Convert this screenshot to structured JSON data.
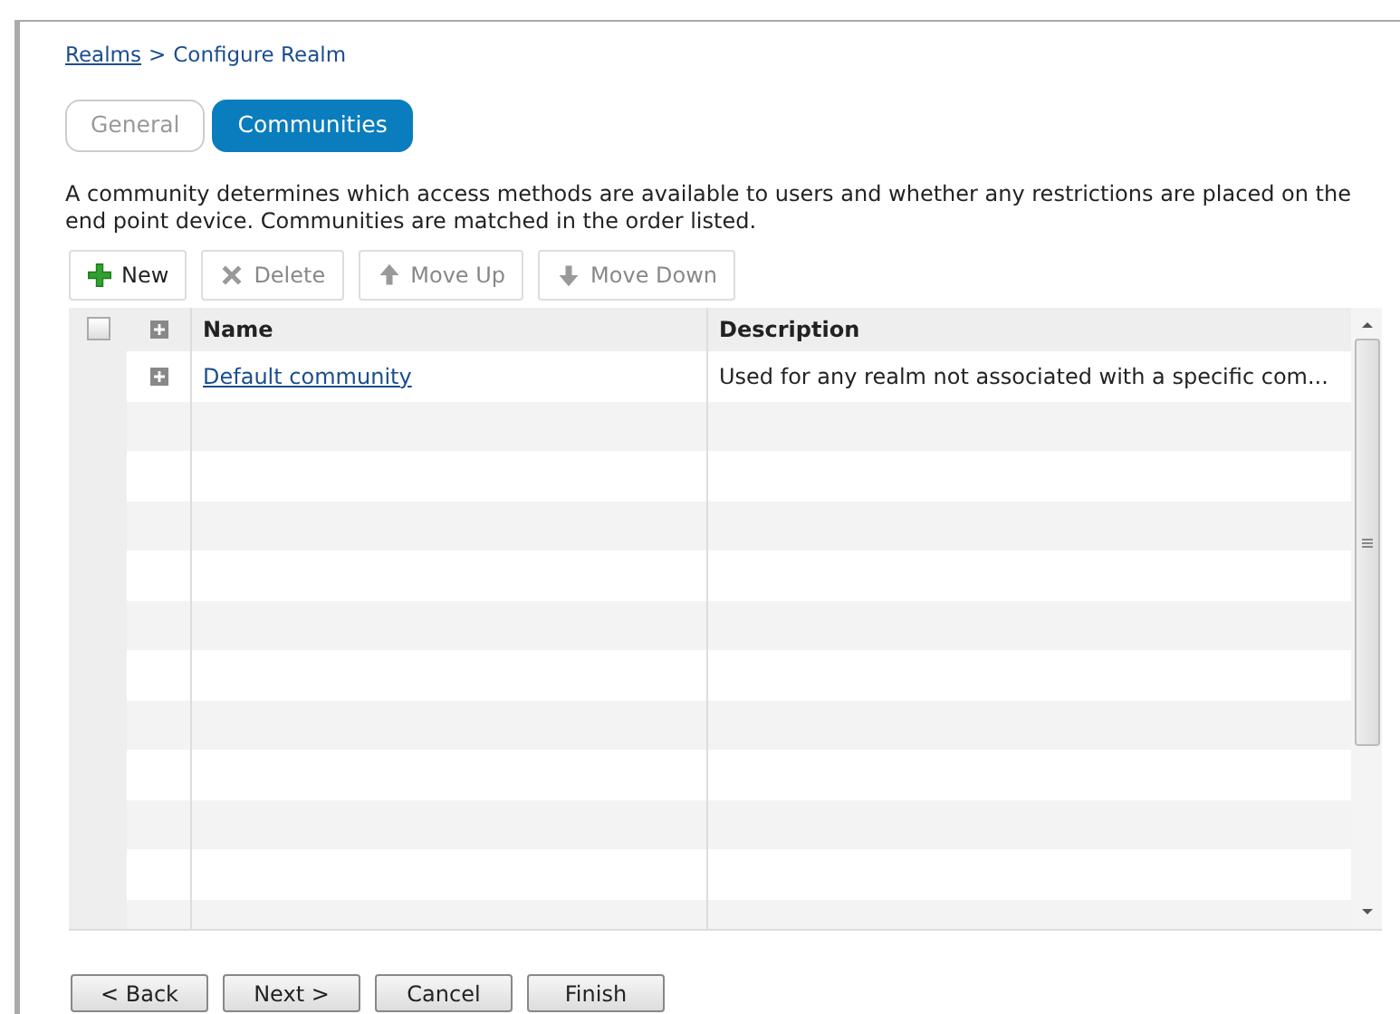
{
  "breadcrumb": {
    "link": "Realms",
    "separator": ">",
    "current": "Configure Realm"
  },
  "tabs": [
    {
      "label": "General",
      "selected": false
    },
    {
      "label": "Communities",
      "selected": true
    }
  ],
  "description": "A community determines which access methods are available to users and whether any restrictions are placed on the end point device. Communities are matched in the order listed.",
  "toolbar": [
    {
      "kind": "new",
      "label": "New",
      "disabled": false
    },
    {
      "kind": "delete",
      "label": "Delete",
      "disabled": true
    },
    {
      "kind": "up",
      "label": "Move Up",
      "disabled": true
    },
    {
      "kind": "down",
      "label": "Move Down",
      "disabled": true
    }
  ],
  "table": {
    "columns": [
      "Name",
      "Description"
    ],
    "select_all_checked": false,
    "rows": [
      {
        "name": "Default community",
        "description": "Used for any realm not associated with a specific com..."
      }
    ]
  },
  "buttons": [
    "< Back",
    "Next >",
    "Cancel",
    "Finish"
  ]
}
